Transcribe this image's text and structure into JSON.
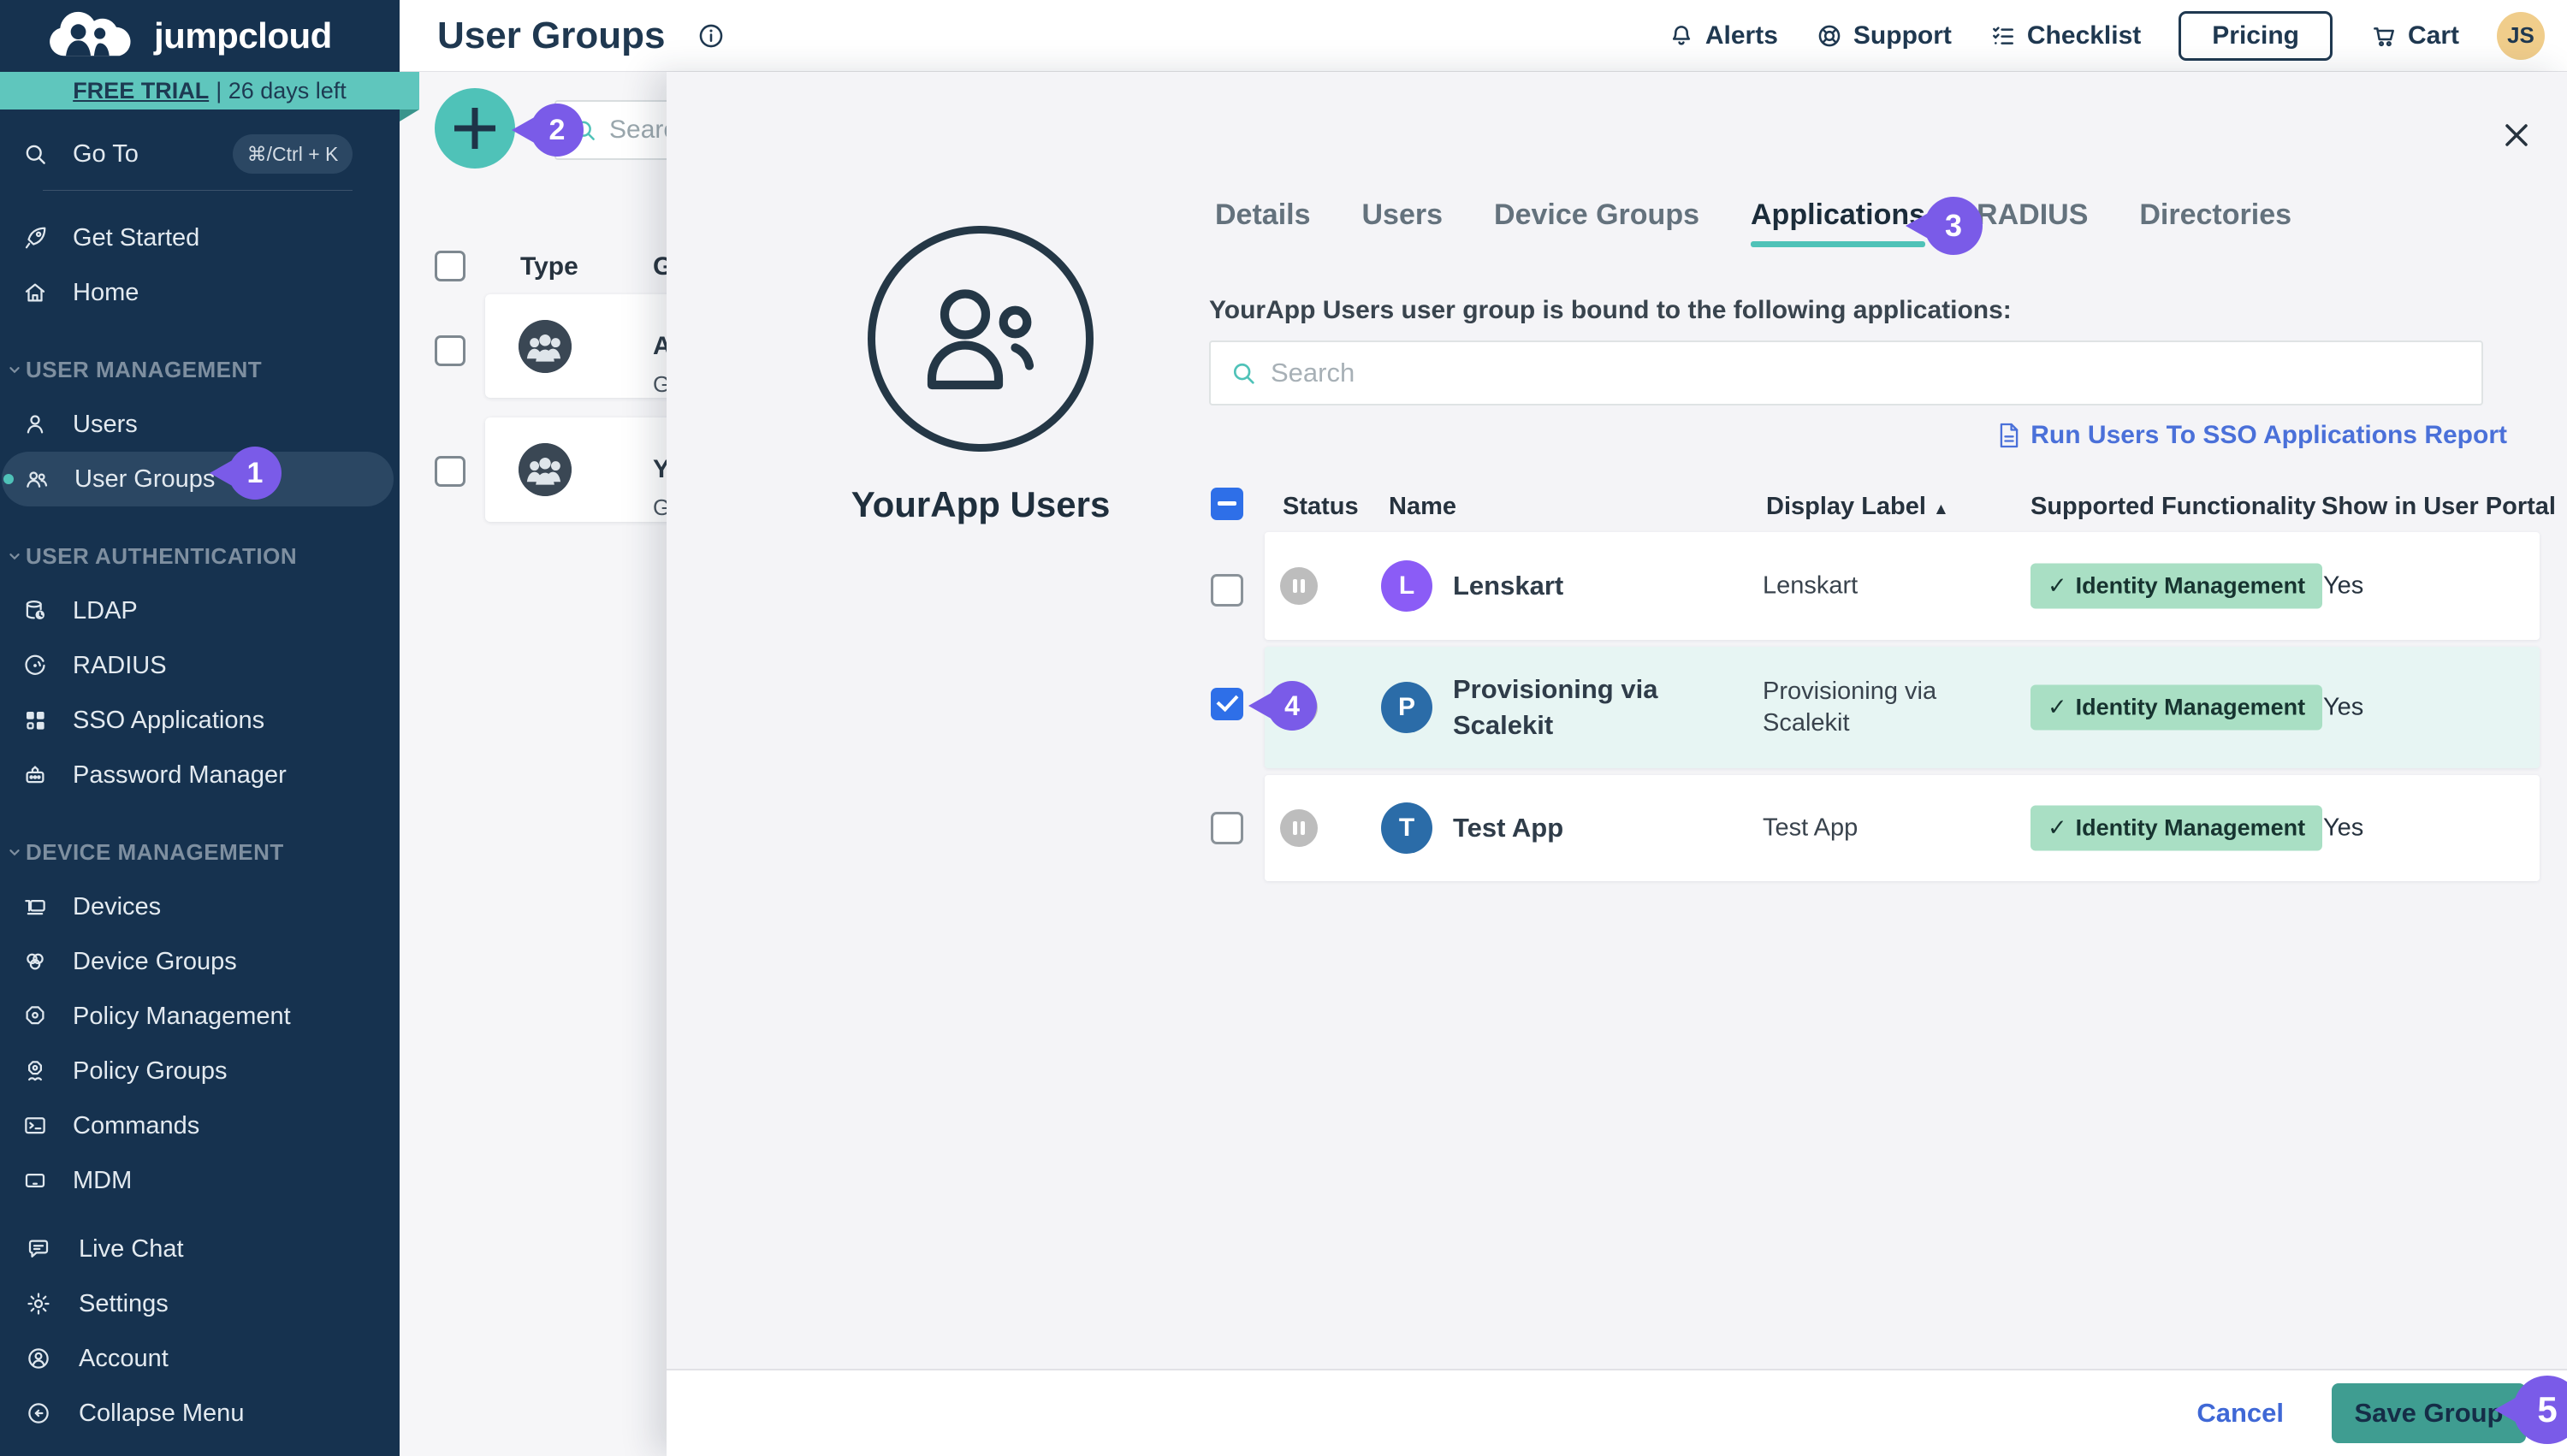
{
  "sidebar": {
    "logo_text": "jumpcloud",
    "trial_banner": {
      "highlight": "FREE TRIAL",
      "rest": "| 26 days left"
    },
    "goto": {
      "label": "Go To",
      "shortcut": "⌘/Ctrl + K"
    },
    "primary_items": [
      {
        "label": "Get Started"
      },
      {
        "label": "Home"
      }
    ],
    "sections": [
      {
        "label": "USER MANAGEMENT",
        "items": [
          {
            "label": "Users"
          },
          {
            "label": "User Groups",
            "active": true
          }
        ]
      },
      {
        "label": "USER AUTHENTICATION",
        "items": [
          {
            "label": "LDAP"
          },
          {
            "label": "RADIUS"
          },
          {
            "label": "SSO Applications"
          },
          {
            "label": "Password Manager"
          }
        ]
      },
      {
        "label": "DEVICE MANAGEMENT",
        "items": [
          {
            "label": "Devices"
          },
          {
            "label": "Device Groups"
          },
          {
            "label": "Policy Management"
          },
          {
            "label": "Policy Groups"
          },
          {
            "label": "Commands"
          },
          {
            "label": "MDM"
          }
        ]
      }
    ],
    "footer_items": [
      {
        "label": "Live Chat"
      },
      {
        "label": "Settings"
      },
      {
        "label": "Account"
      },
      {
        "label": "Collapse Menu"
      }
    ]
  },
  "header": {
    "title": "User Groups",
    "nav_items": [
      {
        "label": "Alerts"
      },
      {
        "label": "Support"
      },
      {
        "label": "Checklist"
      }
    ],
    "pricing_label": "Pricing",
    "cart_label": "Cart",
    "avatar_initials": "JS"
  },
  "background": {
    "search_placeholder": "Search",
    "columns": {
      "type": "Type",
      "group_truncated": "G"
    },
    "rows": [
      {
        "name_truncated": "A",
        "subtitle_truncated": "G"
      },
      {
        "name_truncated": "Y",
        "subtitle_truncated": "G"
      }
    ]
  },
  "panel": {
    "tabs": [
      {
        "label": "Details"
      },
      {
        "label": "Users"
      },
      {
        "label": "Device Groups"
      },
      {
        "label": "Applications",
        "active": true
      },
      {
        "label": "RADIUS"
      },
      {
        "label": "Directories"
      }
    ],
    "group_name": "YourApp Users",
    "description": "YourApp Users user group is bound to the following applications:",
    "search_placeholder": "Search",
    "report_link": "Run Users To SSO Applications Report",
    "table": {
      "headers": {
        "status": "Status",
        "name": "Name",
        "display_label": "Display Label",
        "functionality": "Supported Functionality",
        "portal": "Show in User Portal"
      },
      "rows": [
        {
          "initial": "L",
          "name": "Lenskart",
          "display_label": "Lenskart",
          "functionality": "Identity Management",
          "portal": "Yes",
          "status": "paused",
          "checked": false
        },
        {
          "initial": "P",
          "name": "Provisioning via Scalekit",
          "display_label": "Provisioning via Scalekit",
          "functionality": "Identity Management",
          "portal": "Yes",
          "status": "paused",
          "checked": true
        },
        {
          "initial": "T",
          "name": "Test App",
          "display_label": "Test App",
          "functionality": "Identity Management",
          "portal": "Yes",
          "status": "paused",
          "checked": false
        }
      ]
    },
    "footer": {
      "cancel_label": "Cancel",
      "save_label": "Save Group"
    }
  },
  "annotations": [
    {
      "number": "1"
    },
    {
      "number": "2"
    },
    {
      "number": "3"
    },
    {
      "number": "4"
    },
    {
      "number": "5"
    }
  ],
  "glyphs": {
    "check": "✓",
    "sort_asc": "▲"
  },
  "colors": {
    "sidebar_navy": "#16324F",
    "teal_accent": "#4FC2B8",
    "banner_teal": "#5FC6BD",
    "badge_purple": "#7A5BE8",
    "link_blue": "#4A70D9",
    "checkbox_blue": "#2E6FE8",
    "pill_green": "#A9DFC4",
    "save_teal": "#3F9D91",
    "avatar_gold": "#F0CD8B",
    "avatar_purple": "#8B5CF6",
    "avatar_blue": "#2B6CA8",
    "selected_row": "#E7F5F3"
  }
}
